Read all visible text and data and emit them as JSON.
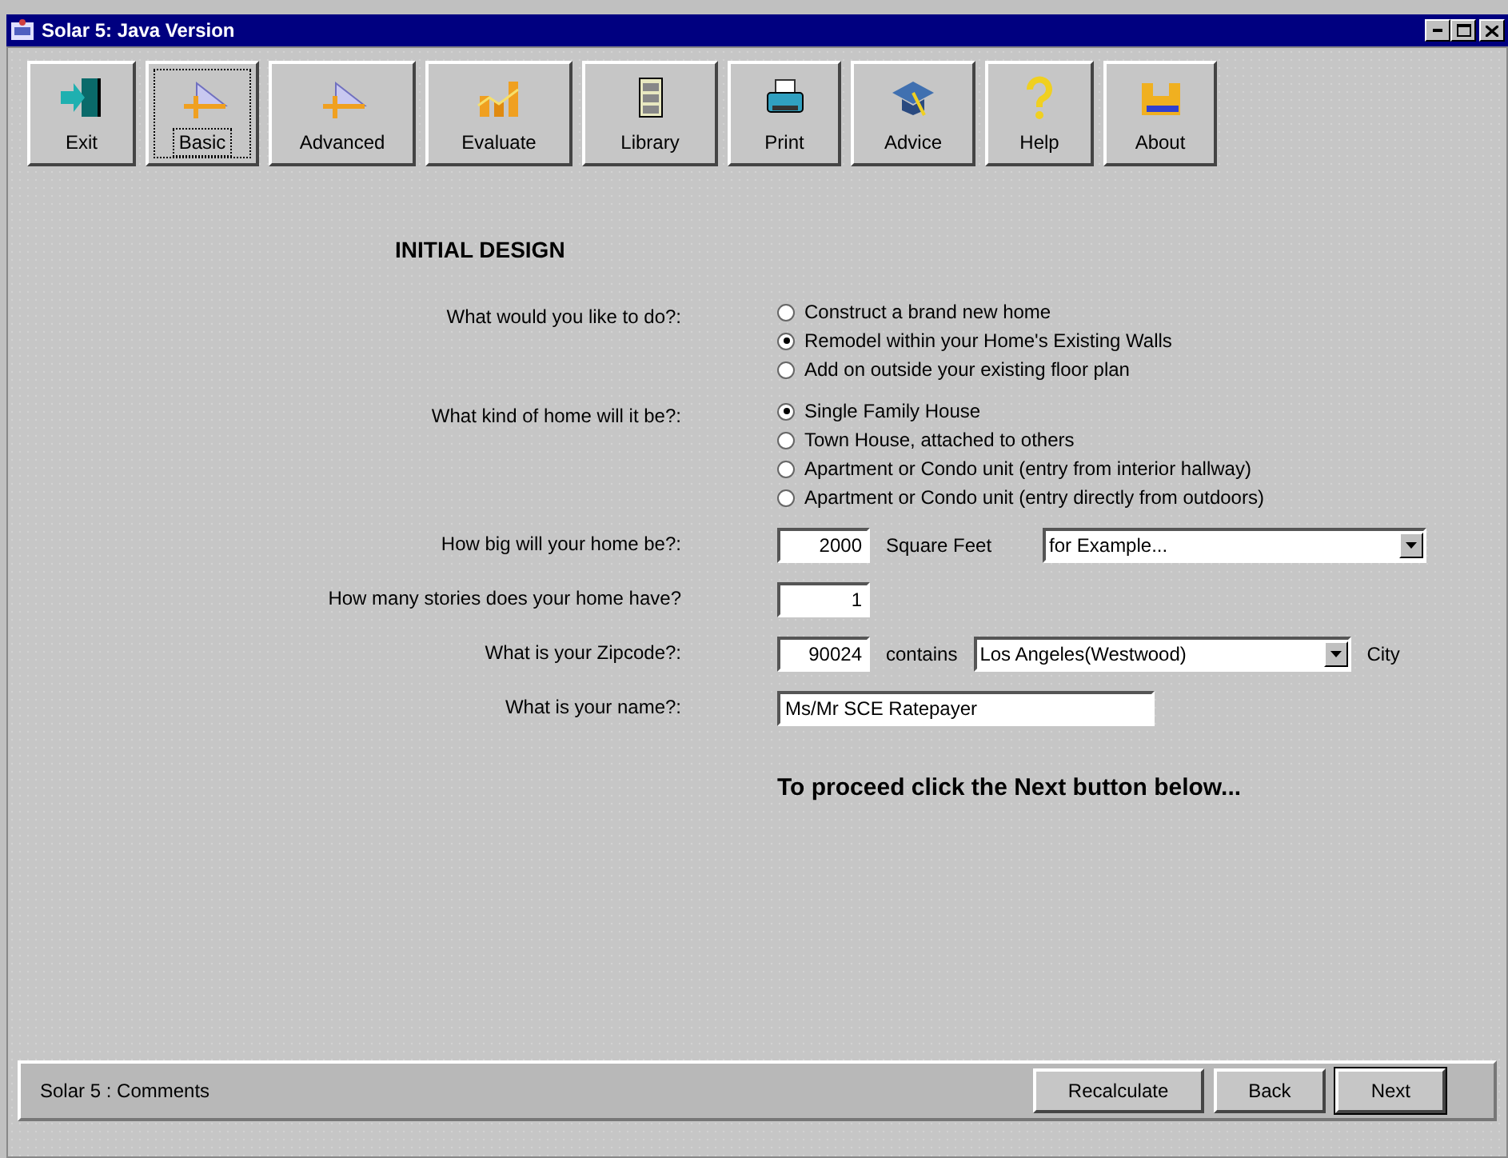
{
  "window": {
    "title": "Solar 5: Java Version"
  },
  "toolbar": [
    {
      "label": "Exit",
      "kind": "exit",
      "selected": false
    },
    {
      "label": "Basic",
      "kind": "ruler",
      "selected": true
    },
    {
      "label": "Advanced",
      "kind": "ruler",
      "selected": false
    },
    {
      "label": "Evaluate",
      "kind": "chart",
      "selected": false
    },
    {
      "label": "Library",
      "kind": "cabinet",
      "selected": false
    },
    {
      "label": "Print",
      "kind": "printer",
      "selected": false
    },
    {
      "label": "Advice",
      "kind": "cap",
      "selected": false
    },
    {
      "label": "Help",
      "kind": "question",
      "selected": false
    },
    {
      "label": "About",
      "kind": "building",
      "selected": false
    }
  ],
  "form": {
    "heading": "INITIAL DESIGN",
    "rows": [
      {
        "kind": "radio",
        "label": "What would you like to do?:",
        "options": [
          {
            "label": "Construct a brand new home",
            "selected": false
          },
          {
            "label": "Remodel within your Home's Existing Walls",
            "selected": true
          },
          {
            "label": "Add on outside your existing floor plan",
            "selected": false
          }
        ]
      },
      {
        "kind": "radio",
        "label": "What kind of home will it be?:",
        "options": [
          {
            "label": "Single Family House",
            "selected": true
          },
          {
            "label": "Town House, attached to others",
            "selected": false
          },
          {
            "label": "Apartment or Condo unit (entry from interior hallway)",
            "selected": false
          },
          {
            "label": "Apartment or Condo unit (entry directly from outdoors)",
            "selected": false
          }
        ]
      },
      {
        "kind": "size",
        "label": "How big will your home be?:",
        "value": "2000",
        "unit": "Square Feet",
        "dropdown": "for Example..."
      },
      {
        "kind": "number",
        "label": "How many stories does your home have?",
        "value": "1"
      },
      {
        "kind": "zip",
        "label": "What is your Zipcode?:",
        "value": "90024",
        "connector": "contains",
        "dropdown": "Los Angeles(Westwood)",
        "suffix": "City"
      },
      {
        "kind": "text",
        "label": "What is your name?:",
        "value": "Ms/Mr SCE Ratepayer"
      }
    ],
    "hint": "To proceed click the Next button below..."
  },
  "status_bar": {
    "comment": "Solar 5 : Comments",
    "buttons": [
      {
        "label": "Recalculate",
        "default": false
      },
      {
        "label": "Back",
        "default": false
      },
      {
        "label": "Next",
        "default": true
      }
    ]
  }
}
